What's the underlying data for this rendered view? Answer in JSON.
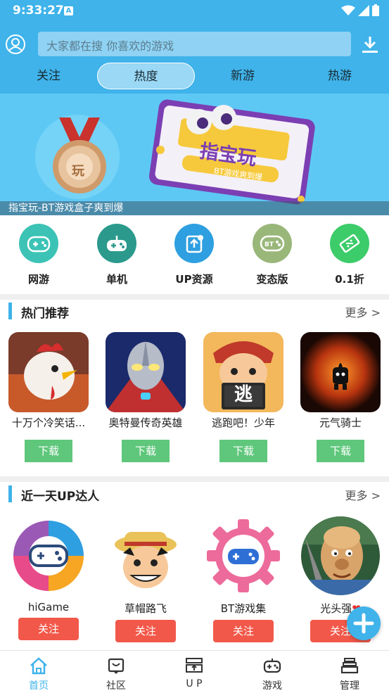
{
  "status_bar": {
    "time": "9:33:27",
    "notification_letter": "A"
  },
  "header": {
    "search_placeholder": "大家都在搜  你喜欢的游戏",
    "tabs": [
      {
        "label": "关注",
        "active": false
      },
      {
        "label": "热度",
        "active": true
      },
      {
        "label": "新游",
        "active": false
      },
      {
        "label": "热游",
        "active": false
      }
    ]
  },
  "banner": {
    "badge_text": "玩",
    "sign_title": "指宝玩",
    "sign_subtitle": "BT游戏爽到爆",
    "caption": "指宝玩-BT游戏盒子爽到爆"
  },
  "categories": [
    {
      "label": "网游",
      "icon": "gamepad-online-icon",
      "color": "#3cc3b6"
    },
    {
      "label": "单机",
      "icon": "gamepad-single-icon",
      "color": "#2b9a8c"
    },
    {
      "label": "UP资源",
      "icon": "upload-resource-icon",
      "color": "#2e9fe0"
    },
    {
      "label": "变态版",
      "icon": "bt-gamepad-icon",
      "color": "#9ab77a"
    },
    {
      "label": "0.1折",
      "icon": "discount-ticket-icon",
      "color": "#3ccc6a"
    }
  ],
  "hot": {
    "title": "热门推荐",
    "more": "更多 >",
    "download_label": "下载",
    "games": [
      {
        "name": "十万个冷笑话...",
        "colors": [
          "#d94a2a",
          "#f4e4d4"
        ]
      },
      {
        "name": "奥特曼传奇英雄",
        "colors": [
          "#1b2a6b",
          "#c03030"
        ]
      },
      {
        "name": "逃跑吧！少年",
        "colors": [
          "#f3b85c",
          "#c0392b"
        ],
        "icon_text": "逃"
      },
      {
        "name": "元气骑士",
        "colors": [
          "#2a0e06",
          "#e2501a"
        ]
      }
    ]
  },
  "up": {
    "title": "近一天UP达人",
    "more": "更多 >",
    "follow_label": "关注",
    "users": [
      {
        "name": "hiGame"
      },
      {
        "name": "草帽路飞"
      },
      {
        "name": "BT游戏集"
      },
      {
        "name": "光头强"
      }
    ]
  },
  "nav": [
    {
      "label": "首页",
      "icon": "home-icon",
      "active": true
    },
    {
      "label": "社区",
      "icon": "community-icon",
      "active": false
    },
    {
      "label": "U P",
      "icon": "up-icon",
      "active": false
    },
    {
      "label": "游戏",
      "icon": "gamepad-icon",
      "active": false
    },
    {
      "label": "管理",
      "icon": "manage-icon",
      "active": false
    }
  ],
  "colors": {
    "primary": "#3fb3ea",
    "download": "#5fc77b",
    "follow": "#f2584a"
  }
}
